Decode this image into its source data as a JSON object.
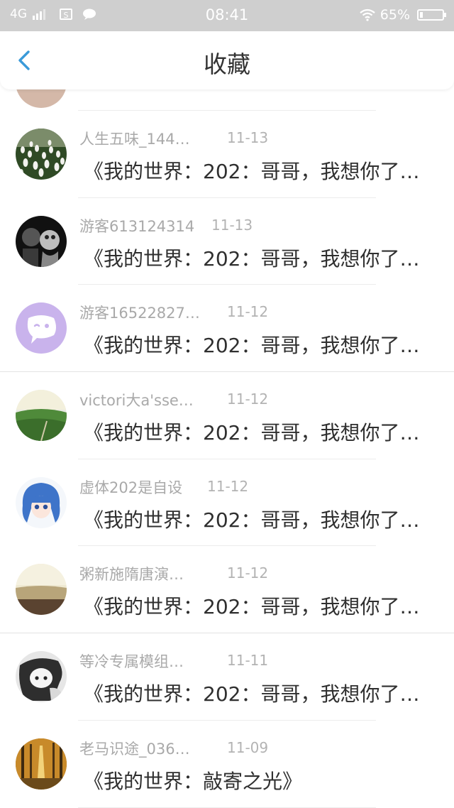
{
  "status_bar": {
    "network": "4G",
    "time": "08:41",
    "battery": "65%"
  },
  "header": {
    "title": "收藏"
  },
  "items": [
    {
      "username": "人生五味_144…",
      "date": "11-13",
      "text": "《我的世界：202：哥哥，我想你了…"
    },
    {
      "username": "游客613124314",
      "date": "11-13",
      "text": "《我的世界：202：哥哥，我想你了…"
    },
    {
      "username": "游客16522827…",
      "date": "11-12",
      "text": "《我的世界：202：哥哥，我想你了…"
    },
    {
      "username": "victori大a'sse…",
      "date": "11-12",
      "text": "《我的世界：202：哥哥，我想你了…"
    },
    {
      "username": "虚体202是自设",
      "date": "11-12",
      "text": "《我的世界：202：哥哥，我想你了…"
    },
    {
      "username": "粥新施隋唐演…",
      "date": "11-12",
      "text": "《我的世界：202：哥哥，我想你了…"
    },
    {
      "username": "等冷专属模组…",
      "date": "11-11",
      "text": "《我的世界：202：哥哥，我想你了…"
    },
    {
      "username": "老马识途_036…",
      "date": "11-09",
      "text": "《我的世界：敲寄之光》"
    }
  ]
}
